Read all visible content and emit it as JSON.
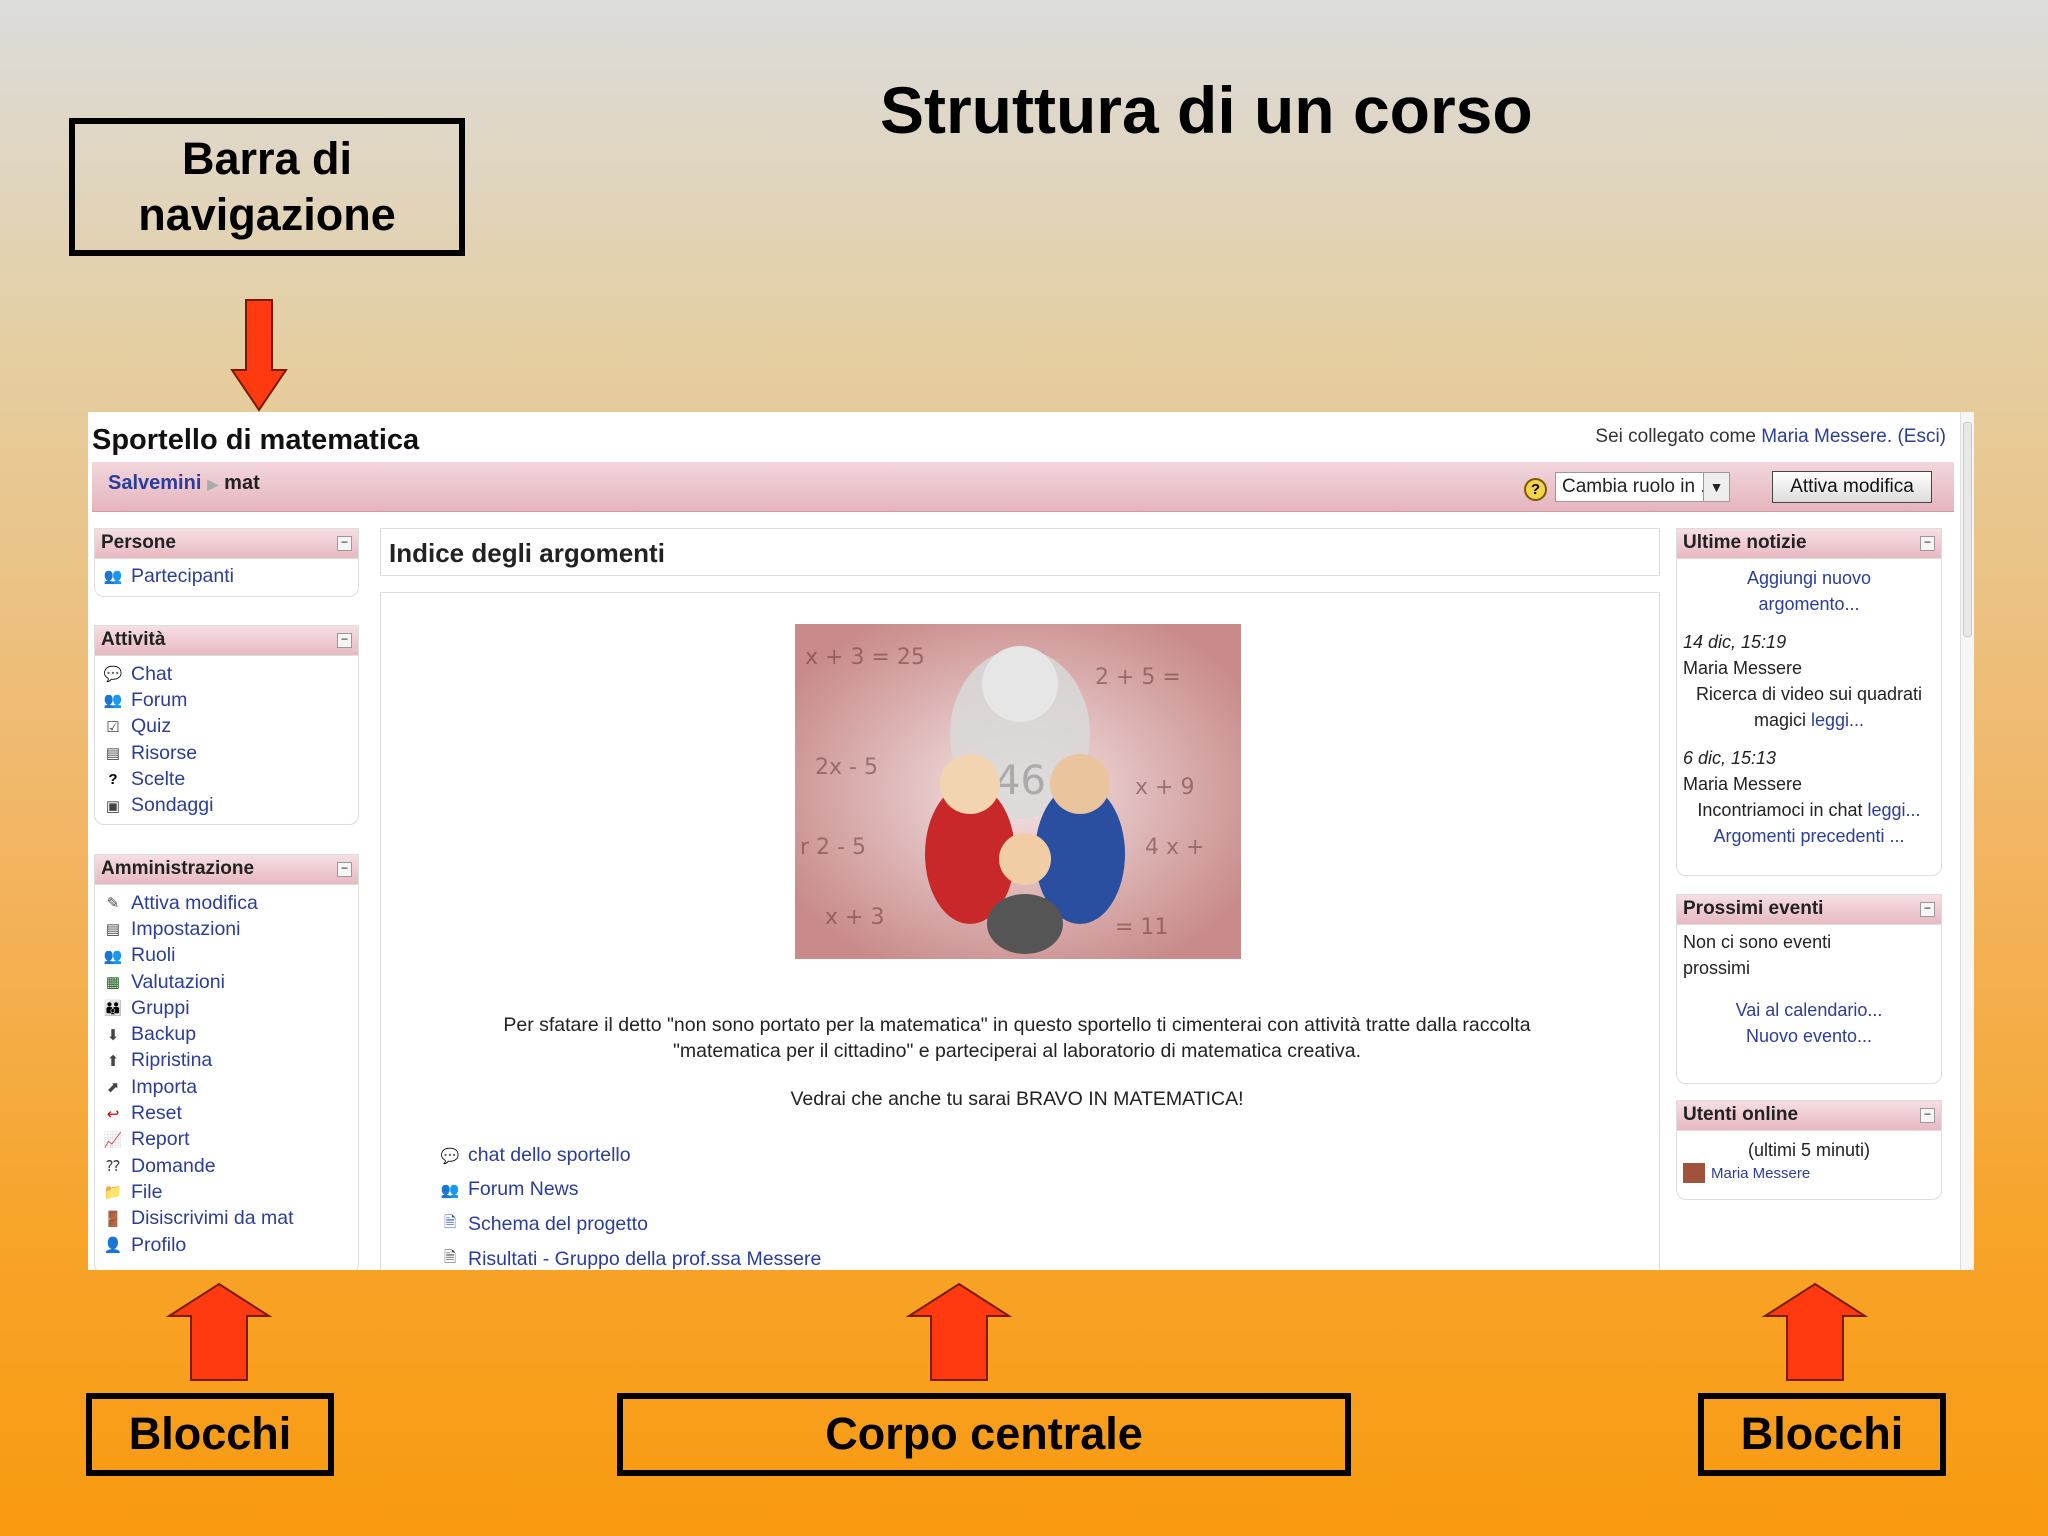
{
  "slide": {
    "title": "Struttura di un corso",
    "callout_nav": "Barra di navigazione",
    "callout_blocks_left": "Blocchi",
    "callout_center": "Corpo centrale",
    "callout_blocks_right": "Blocchi"
  },
  "header": {
    "site_title": "Sportello di matematica",
    "login_prefix": "Sei collegato come",
    "user": "Maria Messere",
    "logout": "(Esci)"
  },
  "navbar": {
    "crumb_home": "Salvemini",
    "crumb_current": "mat",
    "role_select": "Cambia ruolo in ...",
    "edit_button": "Attiva modifica"
  },
  "left_blocks": {
    "persone": {
      "title": "Persone",
      "items": [
        {
          "label": "Partecipanti",
          "icon": "participants-icon"
        }
      ]
    },
    "attivita": {
      "title": "Attività",
      "items": [
        {
          "label": "Chat",
          "icon": "chat-icon"
        },
        {
          "label": "Forum",
          "icon": "forum-icon"
        },
        {
          "label": "Quiz",
          "icon": "quiz-icon"
        },
        {
          "label": "Risorse",
          "icon": "resource-icon"
        },
        {
          "label": "Scelte",
          "icon": "choice-icon"
        },
        {
          "label": "Sondaggi",
          "icon": "survey-icon"
        }
      ]
    },
    "amministrazione": {
      "title": "Amministrazione",
      "items": [
        {
          "label": "Attiva modifica",
          "icon": "edit-icon"
        },
        {
          "label": "Impostazioni",
          "icon": "settings-icon"
        },
        {
          "label": "Ruoli",
          "icon": "roles-icon"
        },
        {
          "label": "Valutazioni",
          "icon": "grades-icon"
        },
        {
          "label": "Gruppi",
          "icon": "groups-icon"
        },
        {
          "label": "Backup",
          "icon": "backup-icon"
        },
        {
          "label": "Ripristina",
          "icon": "restore-icon"
        },
        {
          "label": "Importa",
          "icon": "import-icon"
        },
        {
          "label": "Reset",
          "icon": "reset-icon"
        },
        {
          "label": "Report",
          "icon": "report-icon"
        },
        {
          "label": "Domande",
          "icon": "questions-icon"
        },
        {
          "label": "File",
          "icon": "folder-icon"
        },
        {
          "label": "Disiscrivimi da mat",
          "icon": "unenrol-icon"
        },
        {
          "label": "Profilo",
          "icon": "profile-icon"
        }
      ]
    }
  },
  "main": {
    "heading": "Indice degli argomenti",
    "summary_line1": "Per sfatare il detto \"non sono portato per la matematica\" in questo sportello ti cimenterai con attività tratte dalla raccolta",
    "summary_line2": "\"matematica per il cittadino\" e parteciperai al laboratorio di matematica creativa.",
    "bravo": "Vedrai che anche tu sarai BRAVO IN MATEMATICA!",
    "resources": [
      {
        "label": "chat dello sportello",
        "icon": "chat-icon"
      },
      {
        "label": "Forum News",
        "icon": "forum-icon"
      },
      {
        "label": "Schema del progetto",
        "icon": "word-doc-icon"
      },
      {
        "label": "Risultati - Gruppo della prof.ssa Messere",
        "icon": "results-icon"
      }
    ]
  },
  "right_blocks": {
    "news": {
      "title": "Ultime notizie",
      "add_line1": "Aggiungi nuovo",
      "add_line2": "argomento...",
      "post1_date": "14 dic, 15:19",
      "post1_author": "Maria Messere",
      "post1_text1": "Ricerca di video sui quadrati",
      "post1_text2": "magici",
      "post1_more": "leggi...",
      "post2_date": "6 dic, 15:13",
      "post2_author": "Maria Messere",
      "post2_text": "Incontriamoci in chat",
      "post2_more": "leggi...",
      "older": "Argomenti precedenti ..."
    },
    "events": {
      "title": "Prossimi eventi",
      "none_line1": "Non ci sono eventi",
      "none_line2": "prossimi",
      "calendar": "Vai al calendario...",
      "new_event": "Nuovo evento..."
    },
    "online": {
      "title": "Utenti online",
      "range": "(ultimi 5 minuti)",
      "user": "Maria Messere"
    }
  },
  "colors": {
    "link": "#2a3d9a",
    "block_header": "#e7b9c1",
    "arrow": "#ff3a10"
  }
}
